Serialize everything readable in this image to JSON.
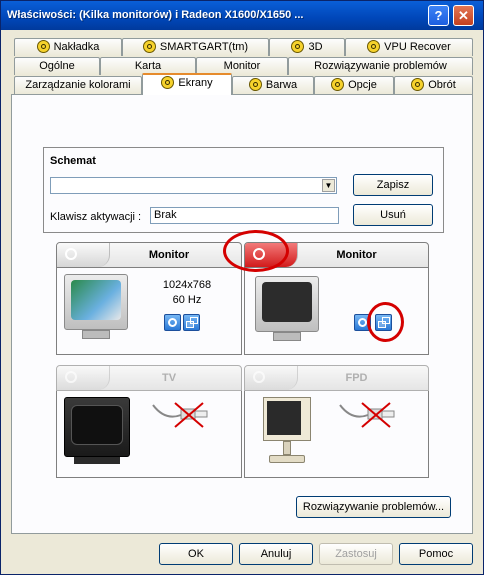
{
  "window": {
    "title": "Właściwości: (Kilka monitorów) i Radeon X1600/X1650 ..."
  },
  "colors": {
    "title_bar": "#0046b8",
    "accent_red": "#d40000",
    "tab_highlight": "#e68b2c"
  },
  "tabs": {
    "row1": [
      {
        "label": "Nakładka",
        "icon": "ati-icon"
      },
      {
        "label": "SMARTGART(tm)",
        "icon": "ati-icon"
      },
      {
        "label": "3D",
        "icon": "ati-icon"
      },
      {
        "label": "VPU Recover",
        "icon": "ati-icon"
      }
    ],
    "row2": [
      {
        "label": "Ogólne"
      },
      {
        "label": "Karta"
      },
      {
        "label": "Monitor"
      },
      {
        "label": "Rozwiązywanie problemów"
      }
    ],
    "row3": [
      {
        "label": "Zarządzanie kolorami"
      },
      {
        "label": "Ekrany",
        "icon": "ati-icon",
        "active": true
      },
      {
        "label": "Barwa",
        "icon": "ati-icon"
      },
      {
        "label": "Opcje",
        "icon": "ati-icon"
      },
      {
        "label": "Obrót",
        "icon": "ati-icon"
      }
    ]
  },
  "scheme": {
    "title": "Schemat",
    "combo_value": "",
    "save_label": "Zapisz",
    "hotkey_label": "Klawisz aktywacji :",
    "hotkey_value": "Brak",
    "delete_label": "Usuń"
  },
  "displays": {
    "monitor1": {
      "label": "Monitor",
      "resolution": "1024x768",
      "refresh": "60 Hz",
      "enabled": true,
      "primary": true
    },
    "monitor2": {
      "label": "Monitor",
      "enabled": true
    },
    "tv": {
      "label": "TV",
      "enabled": false
    },
    "fpd": {
      "label": "FPD",
      "enabled": false
    }
  },
  "troubleshoot_label": "Rozwiązywanie problemów...",
  "footer": {
    "ok": "OK",
    "cancel": "Anuluj",
    "apply": "Zastosuj",
    "help": "Pomoc"
  }
}
